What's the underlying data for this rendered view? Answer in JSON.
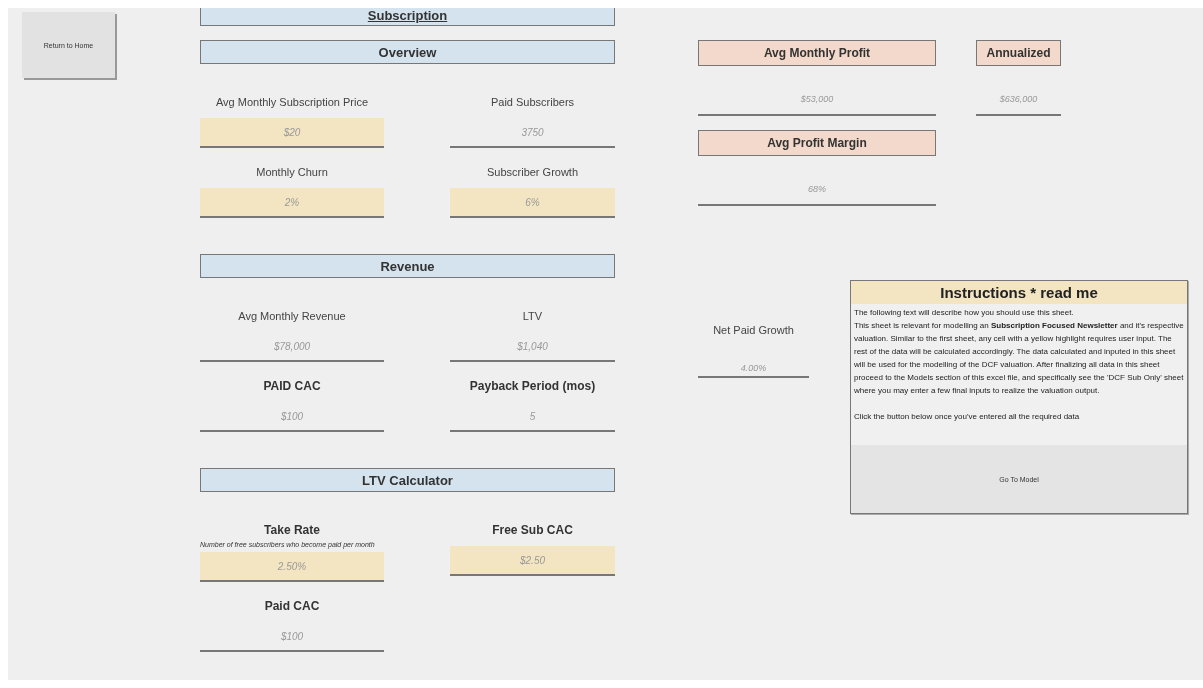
{
  "home_button": {
    "label": "Return to Home"
  },
  "sections": [
    {
      "title": "Subscription",
      "underlined": true
    },
    {
      "title": "Overview",
      "underlined": false,
      "fields": [
        {
          "label": "Avg Monthly Subscription Price",
          "value": "$20",
          "input": true,
          "bold": false
        },
        {
          "label": "Paid Subscribers",
          "value": "3750",
          "input": false,
          "bold": false
        },
        {
          "label": "Monthly Churn",
          "value": "2%",
          "input": true,
          "bold": false
        },
        {
          "label": "Subscriber Growth",
          "value": "6%",
          "input": true,
          "bold": false
        }
      ]
    },
    {
      "title": "Revenue",
      "underlined": false,
      "fields": [
        {
          "label": "Avg Monthly Revenue",
          "value": "$78,000",
          "input": false,
          "bold": false
        },
        {
          "label": "LTV",
          "value": "$1,040",
          "input": false,
          "bold": false
        },
        {
          "label": "PAID CAC",
          "value": "$100",
          "input": false,
          "bold": true
        },
        {
          "label": "Payback Period (mos)",
          "value": "5",
          "input": false,
          "bold": true
        }
      ]
    },
    {
      "title": "LTV Calculator",
      "underlined": false,
      "fields": [
        {
          "label": "Take Rate",
          "note": "Number of free subscribers who become paid per month",
          "value": "2.50%",
          "input": true,
          "bold": true
        },
        {
          "label": "Free Sub CAC",
          "value": "$2.50",
          "input": true,
          "bold": true
        },
        {
          "label": "Paid CAC",
          "value": "$100",
          "input": false,
          "bold": true
        }
      ]
    }
  ],
  "profit_cards": [
    {
      "title": "Avg Monthly Profit",
      "value": "$53,000"
    },
    {
      "title": "Annualized",
      "value": "$636,000"
    },
    {
      "title": "Avg Profit Margin",
      "value": "68%"
    }
  ],
  "net_paid_growth": {
    "label": "Net Paid Growth",
    "value": "4.00%"
  },
  "instructions": {
    "title": "Instructions * read me",
    "paragraphs": [
      "The following text will describe how you should use this sheet.",
      "This sheet is relevant for modelling an **Subscription Focused Newsletter** and it's respective valuation. Similar to the first sheet, any cell with a yellow highlight requires user input. The rest of the data will be calculated accordingly. The data calculated and inputed in this sheet will be used for the modelling of the DCF valuation. After finalizing all data in this sheet proceed to the Models section of this excel file, and specifically see the 'DCF Sub Only' sheet where you may enter a few final inputs to realize the valuation output.",
      "Click the button below once you've entered all the required data"
    ],
    "button": "Go To Model"
  }
}
